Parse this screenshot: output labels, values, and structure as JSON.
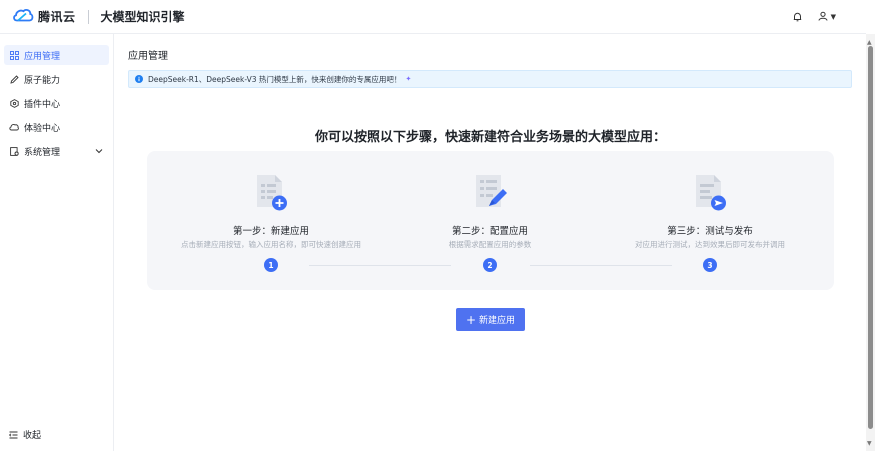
{
  "header": {
    "brand": "腾讯云",
    "product": "大模型知识引擎",
    "icons": [
      "cloud-logo-icon",
      "bell-icon",
      "user-icon",
      "caret-down-icon"
    ]
  },
  "sidebar": {
    "items": [
      {
        "label": "应用管理",
        "icon": "grid-icon",
        "active": true
      },
      {
        "label": "原子能力",
        "icon": "pen-icon",
        "active": false
      },
      {
        "label": "插件中心",
        "icon": "plugin-icon",
        "active": false
      },
      {
        "label": "体验中心",
        "icon": "cloud-icon",
        "active": false
      },
      {
        "label": "系统管理",
        "icon": "settings-icon",
        "active": false,
        "expandable": true
      }
    ],
    "collapse_label": "收起"
  },
  "main": {
    "page_title": "应用管理",
    "notice": "DeepSeek-R1、DeepSeek-V3 热门模型上新，快来创建你的专属应用吧！",
    "headline": "你可以按照以下步骤，快速新建符合业务场景的大模型应用：",
    "steps": [
      {
        "title": "第一步：新建应用",
        "desc": "点击新建应用按钮，输入应用名称，即可快速创建应用",
        "num": "1",
        "icon": "new-app-icon"
      },
      {
        "title": "第二步：配置应用",
        "desc": "根据需求配置应用的参数",
        "num": "2",
        "icon": "configure-app-icon"
      },
      {
        "title": "第三步：测试与发布",
        "desc": "对应用进行测试，达到效果后即可发布并调用",
        "num": "3",
        "icon": "publish-app-icon"
      }
    ],
    "new_button": "新建应用"
  },
  "colors": {
    "accent": "#3d6ef5",
    "button": "#4f72f0",
    "active_bg": "#eef3fe",
    "notice_bg": "#eaf5fe",
    "card_bg": "#f5f6f9"
  }
}
